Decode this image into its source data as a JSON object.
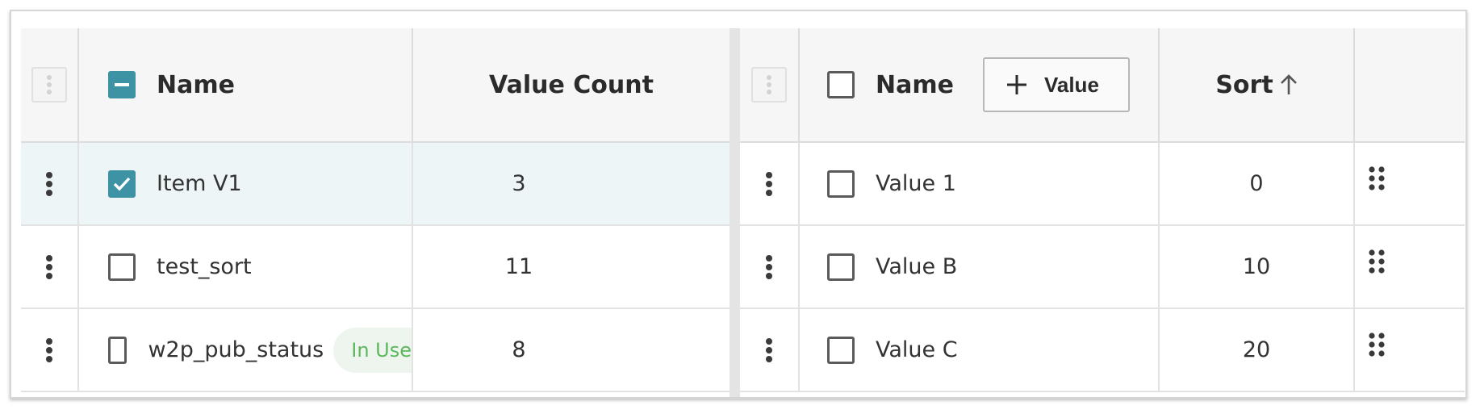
{
  "left_table": {
    "columns": {
      "name": "Name",
      "value_count": "Value Count"
    },
    "rows": [
      {
        "name": "Item V1",
        "count": "3",
        "checked": true,
        "badge": ""
      },
      {
        "name": "test_sort",
        "count": "11",
        "checked": false,
        "badge": ""
      },
      {
        "name": "w2p_pub_status",
        "count": "8",
        "checked": false,
        "badge": "In Use"
      }
    ]
  },
  "right_table": {
    "columns": {
      "name": "Name",
      "sort": "Sort"
    },
    "add_button_label": "Value",
    "rows": [
      {
        "name": "Value 1",
        "sort": "0"
      },
      {
        "name": "Value B",
        "sort": "10"
      },
      {
        "name": "Value C",
        "sort": "20"
      }
    ]
  },
  "colors": {
    "accent": "#3d93a4",
    "badge_text": "#5cb85c",
    "selected_row": "#edf5f7"
  },
  "icons": [
    "drag-handle-icon",
    "kebab-menu-icon",
    "checkbox-icon",
    "plus-icon",
    "arrow-up-icon",
    "grip-dots-icon"
  ]
}
